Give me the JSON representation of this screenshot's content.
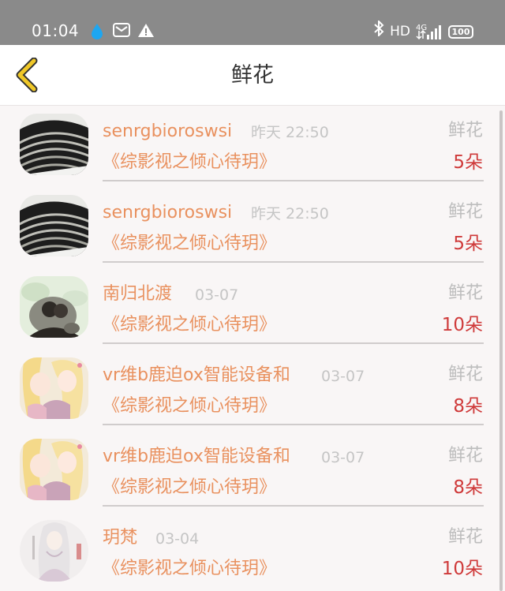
{
  "status_bar": {
    "time": "01:04",
    "network_label": "HD",
    "network_type": "4G",
    "battery": "100",
    "icons": [
      "drop-icon",
      "mail-icon",
      "warning-icon",
      "bluetooth-icon",
      "signal-icon"
    ]
  },
  "nav": {
    "title": "鲜花",
    "back_icon": "chevron-left-icon",
    "accent_color": "#e8c020"
  },
  "colors": {
    "name": "#e9915f",
    "count": "#cf3a3a",
    "muted": "#bdbdbd"
  },
  "items": [
    {
      "name": "senrgbioroswsi",
      "time": "昨天 22:50",
      "type": "鲜花",
      "book": "《综影视之倾心待玥》",
      "count": "5朵",
      "avatar": "fabric-avatar"
    },
    {
      "name": "senrgbioroswsi",
      "time": "昨天 22:50",
      "type": "鲜花",
      "book": "《综影视之倾心待玥》",
      "count": "5朵",
      "avatar": "fabric-avatar"
    },
    {
      "name": "南归北渡",
      "time": "03-07",
      "type": "鲜花",
      "book": "《综影视之倾心待玥》",
      "count": "10朵",
      "avatar": "ink-painting-avatar"
    },
    {
      "name": "vr维b鹿迫ox智能设备和",
      "time": "03-07",
      "type": "鲜花",
      "book": "《综影视之倾心待玥》",
      "count": "8朵",
      "avatar": "anime-couple-avatar"
    },
    {
      "name": "vr维b鹿迫ox智能设备和",
      "time": "03-07",
      "type": "鲜花",
      "book": "《综影视之倾心待玥》",
      "count": "8朵",
      "avatar": "anime-couple-avatar"
    },
    {
      "name": "玥梵",
      "time": "03-04",
      "type": "鲜花",
      "book": "《综影视之倾心待玥》",
      "count": "10朵",
      "avatar": "white-hair-avatar"
    }
  ]
}
